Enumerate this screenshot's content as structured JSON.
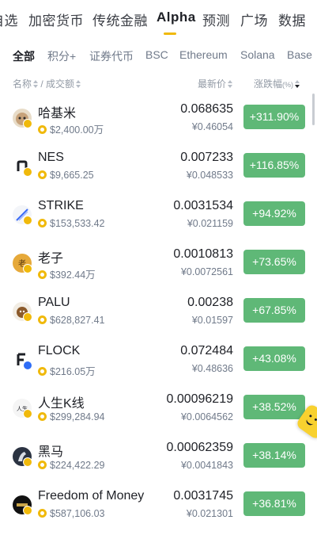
{
  "top_tabs": [
    "自选",
    "加密货币",
    "传统金融",
    "Alpha",
    "预测",
    "广场",
    "数据"
  ],
  "active_top_tab": "Alpha",
  "sub_tabs": [
    "全部",
    "积分+",
    "证券代币",
    "BSC",
    "Ethereum",
    "Solana",
    "Base"
  ],
  "active_sub_tab": "全部",
  "header": {
    "name": "名称",
    "sep": "/",
    "volume": "成交额",
    "price": "最新价",
    "change": "涨跌幅",
    "change_unit": "(%)"
  },
  "colors": {
    "accent": "#f0b90b",
    "up": "#5fb877"
  },
  "rows": [
    {
      "name": "哈基米",
      "volume": "$2,400.00万",
      "price": "0.068635",
      "price_cny": "¥0.46054",
      "change": "+311.90%",
      "icon": "hachimi-logo-icon"
    },
    {
      "name": "NES",
      "volume": "$9,665.25",
      "price": "0.007233",
      "price_cny": "¥0.048533",
      "change": "+116.85%",
      "icon": "nes-logo-icon"
    },
    {
      "name": "STRIKE",
      "volume": "$153,533.42",
      "price": "0.0031534",
      "price_cny": "¥0.021159",
      "change": "+94.92%",
      "icon": "strike-logo-icon"
    },
    {
      "name": "老子",
      "volume": "$392.44万",
      "price": "0.0010813",
      "price_cny": "¥0.0072561",
      "change": "+73.65%",
      "icon": "laozi-logo-icon"
    },
    {
      "name": "PALU",
      "volume": "$628,827.41",
      "price": "0.00238",
      "price_cny": "¥0.01597",
      "change": "+67.85%",
      "icon": "palu-logo-icon"
    },
    {
      "name": "FLOCK",
      "volume": "$216.05万",
      "price": "0.072484",
      "price_cny": "¥0.48636",
      "change": "+43.08%",
      "icon": "flock-logo-icon"
    },
    {
      "name": "人生K线",
      "volume": "$299,284.94",
      "price": "0.00096219",
      "price_cny": "¥0.0064562",
      "change": "+38.52%",
      "icon": "rensheng-logo-icon"
    },
    {
      "name": "黑马",
      "volume": "$224,422.29",
      "price": "0.00062359",
      "price_cny": "¥0.0041843",
      "change": "+38.14%",
      "icon": "heima-logo-icon"
    },
    {
      "name": "Freedom of Money",
      "volume": "$587,106.03",
      "price": "0.0031745",
      "price_cny": "¥0.021301",
      "change": "+36.81%",
      "icon": "freedom-logo-icon"
    }
  ]
}
